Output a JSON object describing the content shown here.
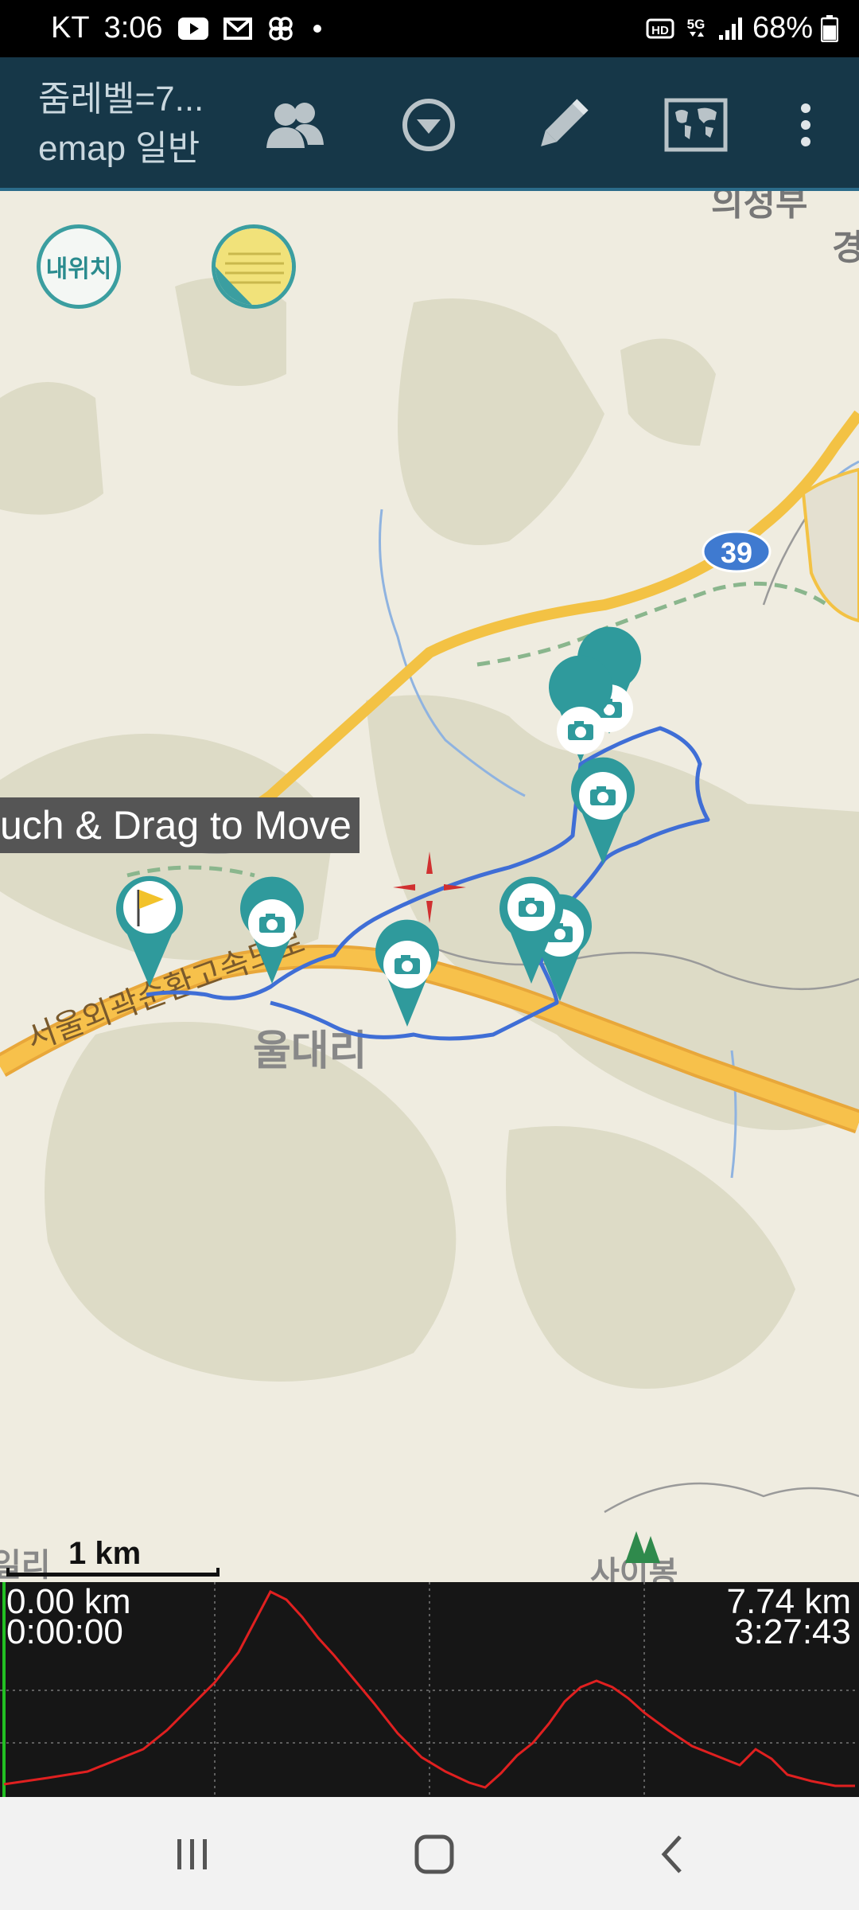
{
  "status_bar": {
    "carrier": "KT",
    "time": "3:06",
    "network_hd": "HD",
    "network_5g": "5G",
    "battery": "68%"
  },
  "app_bar": {
    "title_line1": "줌레벨=7...",
    "title_line2": "emap 일반",
    "icons": [
      "people-icon",
      "dropdown-circle-icon",
      "pencil-icon",
      "world-map-icon",
      "overflow-menu-icon"
    ]
  },
  "map": {
    "my_location_label": "내위치",
    "tooltip": "uch & Drag to Move",
    "route_badge": "39",
    "place_label": "울대리",
    "road_label": "서울외곽순환고속도로",
    "top_right_label_1": "의정부",
    "top_right_label_2": "경",
    "bottom_left_label": "일리",
    "bottom_right_label": "사이봉",
    "scale_label": "1 km",
    "colors": {
      "track": "#3f6ed6",
      "marker": "#2f9a9c",
      "highway": "#f3c244",
      "land": "#efece0",
      "hills": "#dcd9c4"
    }
  },
  "elevation": {
    "start_distance": "0.00 km",
    "start_time": "0:00:00",
    "end_distance": "7.74 km",
    "end_time": "3:27:43",
    "profile_color": "#e02020"
  },
  "nav_bar": {
    "icons": [
      "recent-apps-icon",
      "home-icon",
      "back-icon"
    ]
  }
}
